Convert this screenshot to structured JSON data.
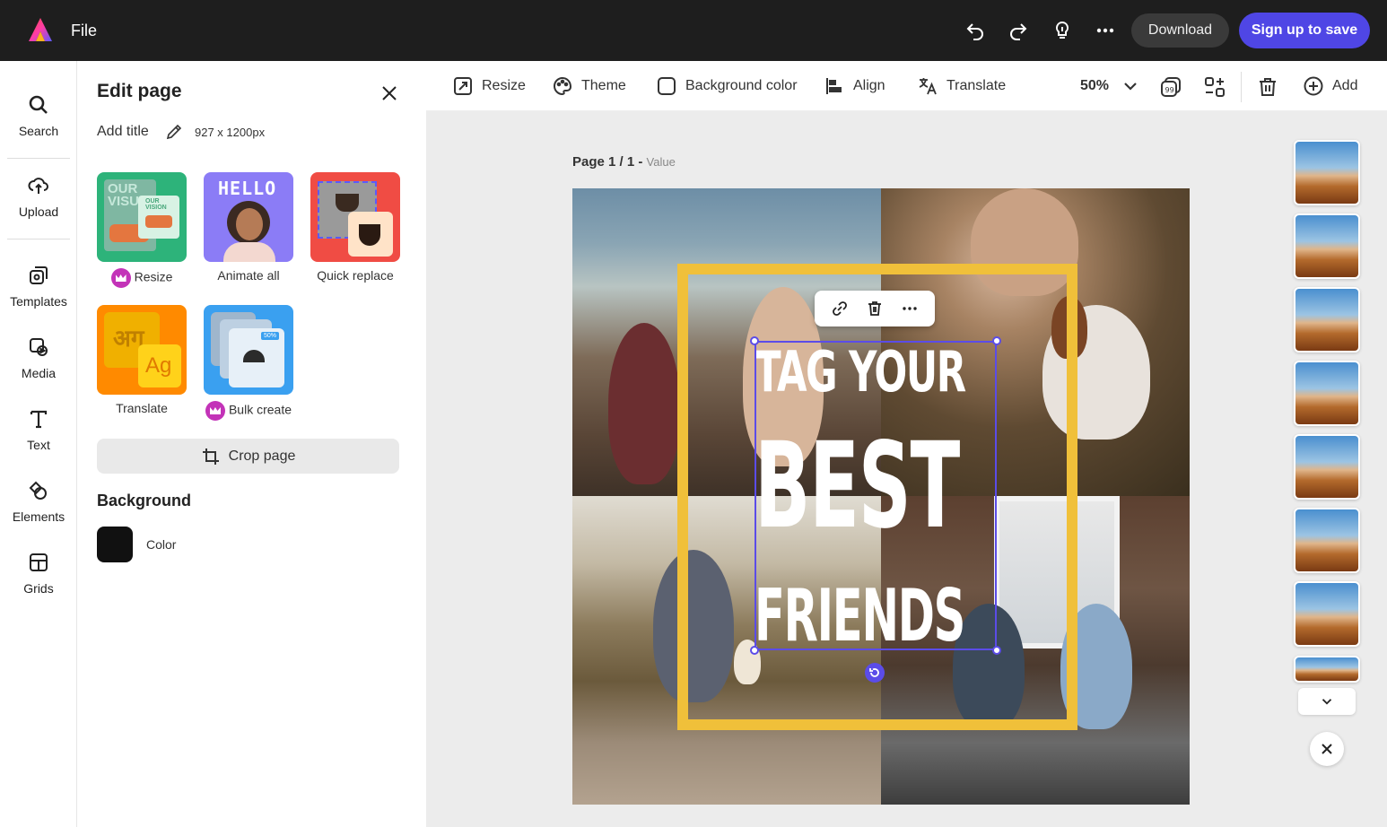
{
  "topbar": {
    "file_label": "File",
    "download_label": "Download",
    "signup_label": "Sign up to save",
    "icons": [
      "undo-icon",
      "redo-icon",
      "lightbulb-icon",
      "more-icon"
    ]
  },
  "rail": {
    "items": [
      {
        "label": "Search",
        "icon": "search-icon"
      },
      {
        "label": "Upload",
        "icon": "upload-icon"
      },
      {
        "label": "Templates",
        "icon": "templates-icon"
      },
      {
        "label": "Media",
        "icon": "media-icon"
      },
      {
        "label": "Text",
        "icon": "text-icon"
      },
      {
        "label": "Elements",
        "icon": "elements-icon"
      },
      {
        "label": "Grids",
        "icon": "grids-icon"
      }
    ]
  },
  "panel": {
    "title": "Edit page",
    "add_title": "Add title",
    "dimensions": "927 x 1200px",
    "tiles": [
      {
        "label": "Resize",
        "premium": true
      },
      {
        "label": "Animate all",
        "premium": false
      },
      {
        "label": "Quick replace",
        "premium": false
      },
      {
        "label": "Translate",
        "premium": false
      },
      {
        "label": "Bulk create",
        "premium": true
      }
    ],
    "tile_art": {
      "resize_text": "OUR VISU",
      "resize_small": "OUR VISION",
      "animate_text": "HELLO",
      "translate_hindi": "अग",
      "translate_latin": "Ag",
      "bulk_badge": "50%"
    },
    "crop_label": "Crop page",
    "background_title": "Background",
    "color_label": "Color",
    "swatch_color": "#111111"
  },
  "toolbar": {
    "resize": "Resize",
    "theme": "Theme",
    "background_color": "Background color",
    "align": "Align",
    "translate": "Translate",
    "zoom": "50%",
    "add": "Add"
  },
  "canvas": {
    "page_label": "Page 1 / 1 - ",
    "page_value": "Value",
    "headline_1": "TAG YOUR",
    "headline_2": "BEST",
    "headline_3": "FRIENDS",
    "frame_color": "#f0c03a",
    "selection_color": "#5b4ce8"
  },
  "thumbnails": {
    "count": 8
  }
}
